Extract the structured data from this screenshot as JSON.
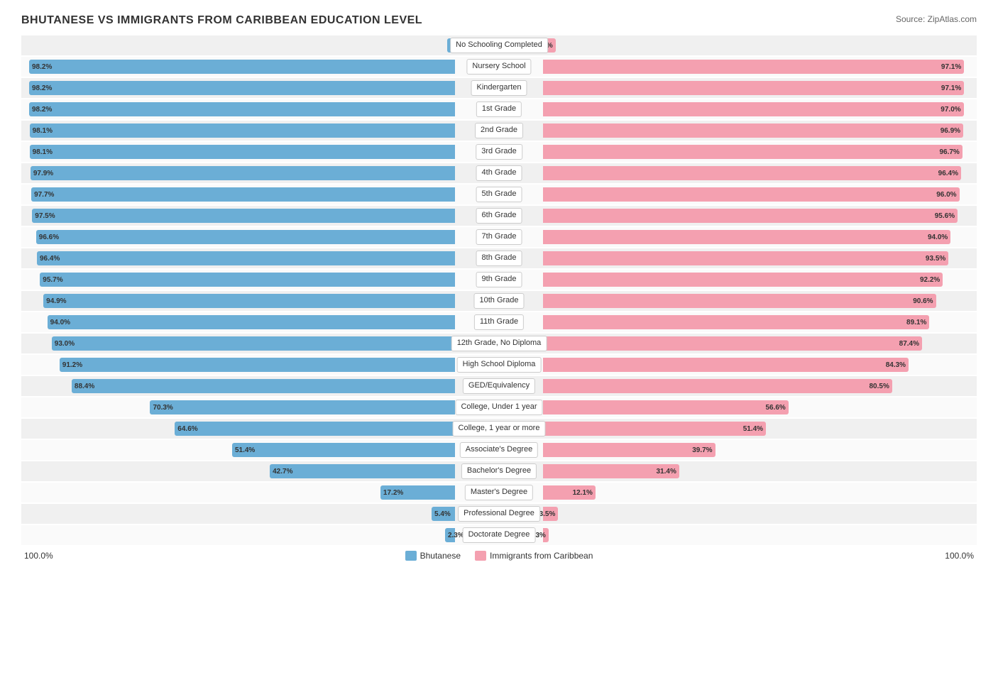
{
  "title": "BHUTANESE VS IMMIGRANTS FROM CARIBBEAN EDUCATION LEVEL",
  "source": "Source: ZipAtlas.com",
  "footer_left": "100.0%",
  "footer_right": "100.0%",
  "legend": [
    {
      "label": "Bhutanese",
      "color": "#6baed6"
    },
    {
      "label": "Immigrants from Caribbean",
      "color": "#f4a0b0"
    }
  ],
  "rows": [
    {
      "label": "No Schooling Completed",
      "blue": 1.8,
      "pink": 2.9,
      "blue_label": "1.8%",
      "pink_label": "2.9%"
    },
    {
      "label": "Nursery School",
      "blue": 98.2,
      "pink": 97.1,
      "blue_label": "98.2%",
      "pink_label": "97.1%"
    },
    {
      "label": "Kindergarten",
      "blue": 98.2,
      "pink": 97.1,
      "blue_label": "98.2%",
      "pink_label": "97.1%"
    },
    {
      "label": "1st Grade",
      "blue": 98.2,
      "pink": 97.0,
      "blue_label": "98.2%",
      "pink_label": "97.0%"
    },
    {
      "label": "2nd Grade",
      "blue": 98.1,
      "pink": 96.9,
      "blue_label": "98.1%",
      "pink_label": "96.9%"
    },
    {
      "label": "3rd Grade",
      "blue": 98.1,
      "pink": 96.7,
      "blue_label": "98.1%",
      "pink_label": "96.7%"
    },
    {
      "label": "4th Grade",
      "blue": 97.9,
      "pink": 96.4,
      "blue_label": "97.9%",
      "pink_label": "96.4%"
    },
    {
      "label": "5th Grade",
      "blue": 97.7,
      "pink": 96.0,
      "blue_label": "97.7%",
      "pink_label": "96.0%"
    },
    {
      "label": "6th Grade",
      "blue": 97.5,
      "pink": 95.6,
      "blue_label": "97.5%",
      "pink_label": "95.6%"
    },
    {
      "label": "7th Grade",
      "blue": 96.6,
      "pink": 94.0,
      "blue_label": "96.6%",
      "pink_label": "94.0%"
    },
    {
      "label": "8th Grade",
      "blue": 96.4,
      "pink": 93.5,
      "blue_label": "96.4%",
      "pink_label": "93.5%"
    },
    {
      "label": "9th Grade",
      "blue": 95.7,
      "pink": 92.2,
      "blue_label": "95.7%",
      "pink_label": "92.2%"
    },
    {
      "label": "10th Grade",
      "blue": 94.9,
      "pink": 90.6,
      "blue_label": "94.9%",
      "pink_label": "90.6%"
    },
    {
      "label": "11th Grade",
      "blue": 94.0,
      "pink": 89.1,
      "blue_label": "94.0%",
      "pink_label": "89.1%"
    },
    {
      "label": "12th Grade, No Diploma",
      "blue": 93.0,
      "pink": 87.4,
      "blue_label": "93.0%",
      "pink_label": "87.4%"
    },
    {
      "label": "High School Diploma",
      "blue": 91.2,
      "pink": 84.3,
      "blue_label": "91.2%",
      "pink_label": "84.3%"
    },
    {
      "label": "GED/Equivalency",
      "blue": 88.4,
      "pink": 80.5,
      "blue_label": "88.4%",
      "pink_label": "80.5%"
    },
    {
      "label": "College, Under 1 year",
      "blue": 70.3,
      "pink": 56.6,
      "blue_label": "70.3%",
      "pink_label": "56.6%"
    },
    {
      "label": "College, 1 year or more",
      "blue": 64.6,
      "pink": 51.4,
      "blue_label": "64.6%",
      "pink_label": "51.4%"
    },
    {
      "label": "Associate's Degree",
      "blue": 51.4,
      "pink": 39.7,
      "blue_label": "51.4%",
      "pink_label": "39.7%"
    },
    {
      "label": "Bachelor's Degree",
      "blue": 42.7,
      "pink": 31.4,
      "blue_label": "42.7%",
      "pink_label": "31.4%"
    },
    {
      "label": "Master's Degree",
      "blue": 17.2,
      "pink": 12.1,
      "blue_label": "17.2%",
      "pink_label": "12.1%"
    },
    {
      "label": "Professional Degree",
      "blue": 5.4,
      "pink": 3.5,
      "blue_label": "5.4%",
      "pink_label": "3.5%"
    },
    {
      "label": "Doctorate Degree",
      "blue": 2.3,
      "pink": 1.3,
      "blue_label": "2.3%",
      "pink_label": "1.3%"
    }
  ]
}
